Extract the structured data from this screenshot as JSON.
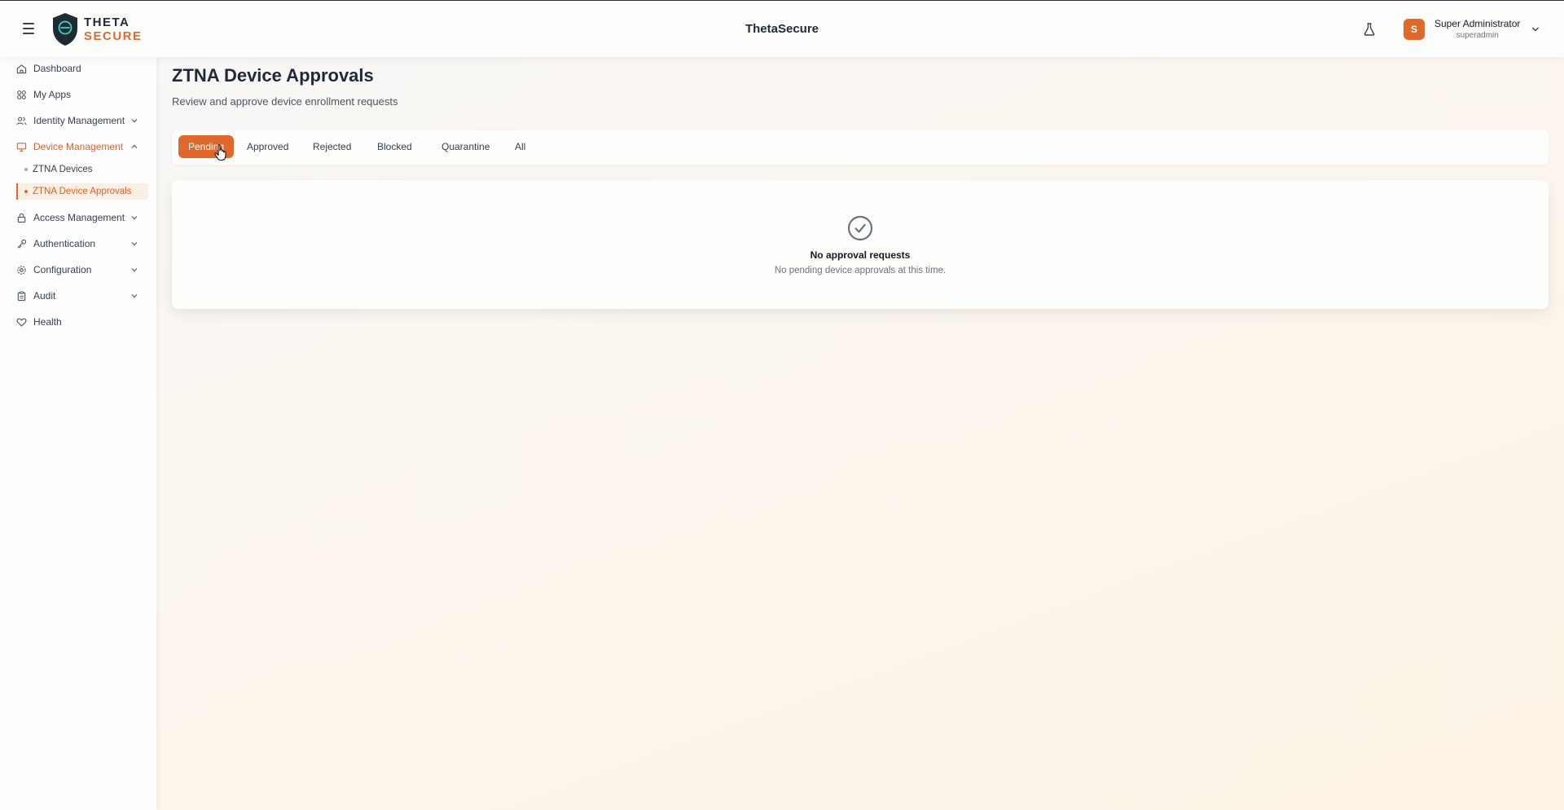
{
  "app": {
    "title": "ThetaSecure"
  },
  "logo": {
    "line1": "THETA",
    "line2": "SECURE"
  },
  "header": {
    "user": {
      "initial": "S",
      "name": "Super Administrator",
      "login": "superadmin"
    }
  },
  "sidebar": {
    "items": [
      {
        "label": "Dashboard",
        "icon": "home-icon"
      },
      {
        "label": "My Apps",
        "icon": "apps-grid-icon"
      },
      {
        "label": "Identity Management",
        "icon": "users-icon",
        "chevron": "down"
      },
      {
        "label": "Device Management",
        "icon": "monitor-icon",
        "chevron": "up",
        "active": true
      },
      {
        "label": "Access Management",
        "icon": "lock-icon",
        "chevron": "down"
      },
      {
        "label": "Authentication",
        "icon": "key-icon",
        "chevron": "down"
      },
      {
        "label": "Configuration",
        "icon": "gear-icon",
        "chevron": "down"
      },
      {
        "label": "Audit",
        "icon": "clipboard-icon",
        "chevron": "down"
      },
      {
        "label": "Health",
        "icon": "heart-icon"
      }
    ],
    "sub_items": [
      {
        "label": "ZTNA Devices"
      },
      {
        "label": "ZTNA Device Approvals",
        "selected": true
      }
    ]
  },
  "main": {
    "title": "ZTNA Device Approvals",
    "subtitle": "Review and approve device enrollment requests",
    "tabs": [
      {
        "label": "Pending",
        "active": true
      },
      {
        "label": "Approved"
      },
      {
        "label": "Rejected"
      },
      {
        "label": "Blocked"
      },
      {
        "label": "Quarantine"
      },
      {
        "label": "All"
      }
    ],
    "empty": {
      "title": "No approval requests",
      "description": "No pending device approvals at this time."
    }
  },
  "colors": {
    "accent": "#e0682a",
    "text": "#1f2937",
    "muted": "#6b7280"
  }
}
